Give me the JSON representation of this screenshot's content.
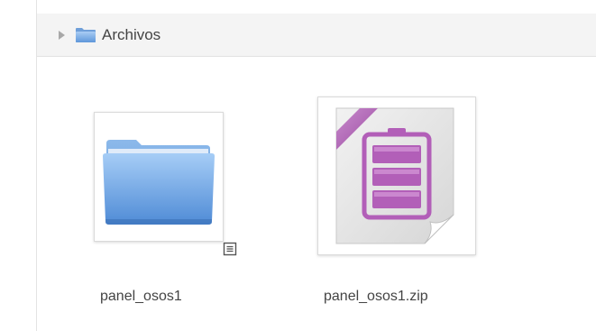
{
  "breadcrumb": {
    "folder_label": "Archivos",
    "expand_icon": "triangle-right-icon",
    "folder_icon": "folder-icon"
  },
  "files": [
    {
      "name": "panel_osos1",
      "type": "folder",
      "icon": "folder-icon",
      "has_info_icon": true
    },
    {
      "name": "panel_osos1.zip",
      "type": "archive",
      "icon": "zip-archive-icon",
      "has_info_icon": false
    }
  ],
  "colors": {
    "folder_blue": "#7fb0e8",
    "archive_purple": "#b25fb8",
    "text": "#444444"
  }
}
